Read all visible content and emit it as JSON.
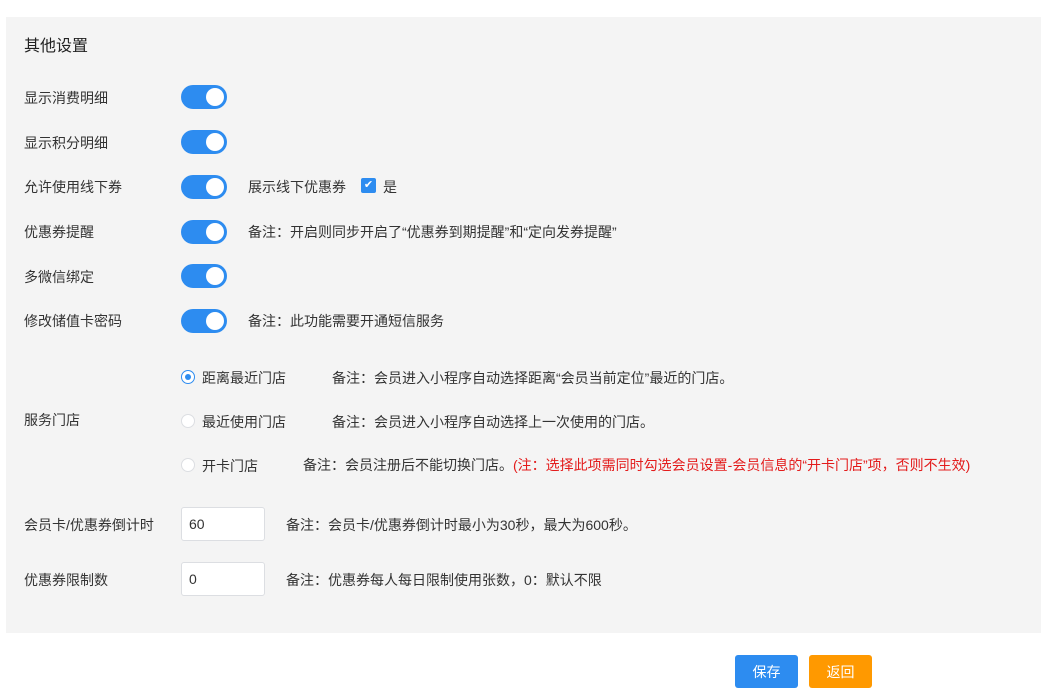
{
  "section_title": "其他设置",
  "rows": {
    "consume_detail": {
      "label": "显示消费明细",
      "enabled": true
    },
    "points_detail": {
      "label": "显示积分明细",
      "enabled": true
    },
    "offline_coupon": {
      "label": "允许使用线下券",
      "enabled": true,
      "extra_label": "展示线下优惠券",
      "checkbox_checked": true,
      "checkbox_label": "是"
    },
    "coupon_reminder": {
      "label": "优惠券提醒",
      "enabled": true,
      "note": "备注：开启则同步开启了“优惠券到期提醒”和“定向发券提醒”"
    },
    "multi_wechat": {
      "label": "多微信绑定",
      "enabled": true
    },
    "change_card_pwd": {
      "label": "修改储值卡密码",
      "enabled": true,
      "note": "备注：此功能需要开通短信服务"
    }
  },
  "service_store": {
    "label": "服务门店",
    "selected": "nearest",
    "options": [
      {
        "key": "nearest",
        "label": "距离最近门店",
        "note": "备注：会员进入小程序自动选择距离“会员当前定位”最近的门店。"
      },
      {
        "key": "recent",
        "label": "最近使用门店",
        "note": "备注：会员进入小程序自动选择上一次使用的门店。"
      },
      {
        "key": "opening",
        "label": "开卡门店",
        "note": "备注：会员注册后不能切换门店。",
        "warning": "(注：选择此项需同时勾选会员设置-会员信息的“开卡门店”项，否则不生效)"
      }
    ]
  },
  "countdown": {
    "label": "会员卡/优惠券倒计时",
    "value": "60",
    "note": "备注：会员卡/优惠券倒计时最小为30秒，最大为600秒。"
  },
  "coupon_limit": {
    "label": "优惠券限制数",
    "value": "0",
    "note": "备注：优惠券每人每日限制使用张数，0：默认不限"
  },
  "buttons": {
    "save": "保存",
    "back": "返回"
  },
  "colors": {
    "accent": "#2d8cf0",
    "warning": "#e31b1b",
    "back_button": "#ff9900",
    "panel_bg": "#f4f4f4"
  }
}
